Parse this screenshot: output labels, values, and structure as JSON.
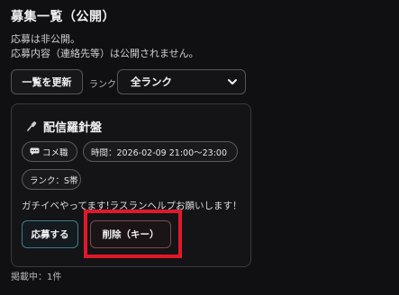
{
  "header": {
    "title": "募集一覧（公開）",
    "notice_line1": "応募は非公開。",
    "notice_line2": "応募内容（連絡先等）は公開されません。"
  },
  "toolbar": {
    "refresh_label": "一覧を更新",
    "rank_label": "ランク",
    "rank_select_value": "全ランク"
  },
  "listing": {
    "title": "配信羅針盤",
    "title_icon": "microphone-icon",
    "category_chip": "コメ職",
    "category_icon": "chat-bubble-icon",
    "time_chip": "時間：2026-02-09 21:00〜23:00",
    "rank_chip": "ランク：S帯",
    "description": "ガチイベやってます!ラスランヘルプお願いします！",
    "apply_label": "応募する",
    "delete_label": "削除（キー）"
  },
  "footer": {
    "count_text": "掲載中：1件"
  },
  "colors": {
    "background": "#101012",
    "highlight": "#e0192a",
    "apply_border": "#3d7b8e",
    "delete_border": "#7a4a52"
  }
}
